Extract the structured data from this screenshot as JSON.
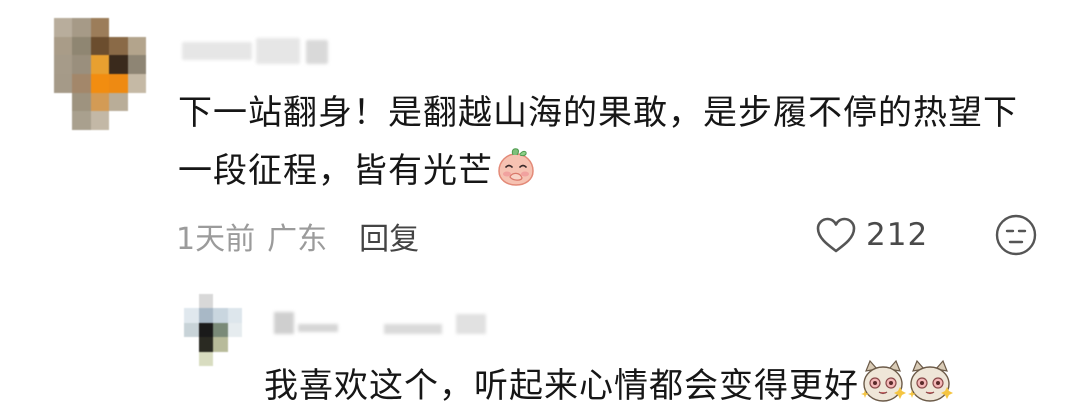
{
  "comment": {
    "username": "",
    "text": "下一站翻身！是翻越山海的果敢，是步履不停的热望下一段征程，皆有光芒",
    "emoji_icon": "peach-shy-emoji",
    "time": "1天前",
    "location": "广东",
    "reply_label": "回复",
    "like_count": "212",
    "like_icon": "heart-outline-icon",
    "dislike_icon": "speechless-face-icon"
  },
  "reply": {
    "username": "",
    "text": "我喜欢这个，听起来心情都会变得更好",
    "emoji_icons": [
      "cat-sparkle-emoji",
      "cat-sparkle-emoji"
    ]
  },
  "colors": {
    "text_primary": "#161616",
    "text_secondary": "#9b9b9b",
    "reply_link": "#444444",
    "background": "#ffffff"
  }
}
